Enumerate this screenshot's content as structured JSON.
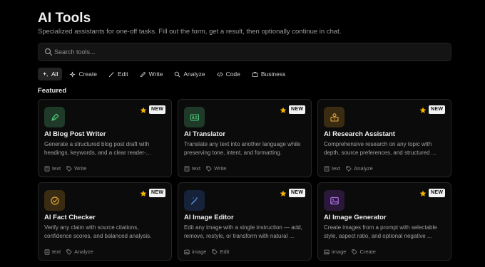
{
  "header": {
    "title": "AI Tools",
    "subtitle": "Specialized assistants for one-off tasks. Fill out the form, get a result, then optionally continue in chat."
  },
  "search": {
    "placeholder": "Search tools...",
    "value": ""
  },
  "filters": [
    {
      "label": "All",
      "icon": "sparkles-icon",
      "active": true
    },
    {
      "label": "Create",
      "icon": "create-sparkle-icon",
      "active": false
    },
    {
      "label": "Edit",
      "icon": "magic-wand-icon",
      "active": false
    },
    {
      "label": "Write",
      "icon": "pen-icon",
      "active": false
    },
    {
      "label": "Analyze",
      "icon": "magnifier-icon",
      "active": false
    },
    {
      "label": "Code",
      "icon": "code-icon",
      "active": false
    },
    {
      "label": "Business",
      "icon": "briefcase-icon",
      "active": false
    }
  ],
  "section_title": "Featured",
  "colors": {
    "star": "#f5b400",
    "green": "#1f3a28",
    "gold": "#3a2c12",
    "blue": "#16223a",
    "purple": "#2a1838"
  },
  "cards": [
    {
      "name": "AI Blog Post Writer",
      "desc": "Generate a structured blog post draft with headings, keywords, and a clear reader-...",
      "badge": "NEW",
      "type": "text",
      "category": "Write",
      "icon": "pen-nib-icon"
    },
    {
      "name": "AI Translator",
      "desc": "Translate any text into another language while preserving tone, intent, and formatting.",
      "badge": "NEW",
      "type": "text",
      "category": "Write",
      "icon": "translate-icon"
    },
    {
      "name": "AI Research Assistant",
      "desc": "Comprehensive research on any topic with depth, source preferences, and structured ...",
      "badge": "NEW",
      "type": "text",
      "category": "Analyze",
      "icon": "research-icon"
    },
    {
      "name": "AI Fact Checker",
      "desc": "Verify any claim with source citations, confidence scores, and balanced analysis.",
      "badge": "NEW",
      "type": "text",
      "category": "Analyze",
      "icon": "check-circle-icon"
    },
    {
      "name": "AI Image Editor",
      "desc": "Edit any image with a single instruction — add, remove, restyle, or transform with natural ...",
      "badge": "NEW",
      "type": "image",
      "category": "Edit",
      "icon": "magic-wand-icon"
    },
    {
      "name": "AI Image Generator",
      "desc": "Create images from a prompt with selectable style, aspect ratio, and optional negative ...",
      "badge": "NEW",
      "type": "image",
      "category": "Create",
      "icon": "image-icon"
    }
  ]
}
